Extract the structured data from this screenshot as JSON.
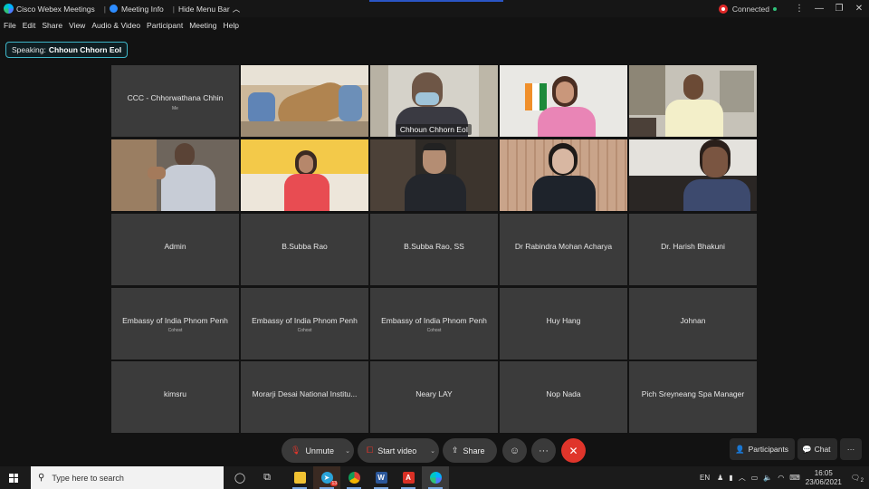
{
  "titlebar": {
    "app_title": "Cisco Webex Meetings",
    "separator": "|",
    "meeting_info": "Meeting Info",
    "hide_menu": "Hide Menu Bar",
    "hide_menu_icon": "chevron-up-icon",
    "status": "Connected",
    "status_color": "#2fc27a",
    "recording_color": "#e02828"
  },
  "menu": [
    "File",
    "Edit",
    "Share",
    "View",
    "Audio & Video",
    "Participant",
    "Meeting",
    "Help"
  ],
  "speaking": {
    "label": "Speaking:",
    "name": "Chhoun Chhorn EoI",
    "border_color": "#3fb6c8"
  },
  "tiles": [
    {
      "name": "CCC - Chhorwathana Chhin",
      "sub": "Me",
      "video": false
    },
    {
      "name": "",
      "sub": "",
      "video": true
    },
    {
      "name": "Chhoun Chhorn EoI",
      "sub": "",
      "video": true,
      "active": true
    },
    {
      "name": "",
      "sub": "",
      "video": true
    },
    {
      "name": "",
      "sub": "",
      "video": true
    },
    {
      "name": "",
      "sub": "",
      "video": true
    },
    {
      "name": "",
      "sub": "",
      "video": true
    },
    {
      "name": "",
      "sub": "",
      "video": true
    },
    {
      "name": "",
      "sub": "",
      "video": true
    },
    {
      "name": "",
      "sub": "",
      "video": true
    },
    {
      "name": "Admin",
      "sub": "",
      "video": false
    },
    {
      "name": "B.Subba Rao",
      "sub": "",
      "video": false
    },
    {
      "name": "B.Subba Rao, SS",
      "sub": "",
      "video": false
    },
    {
      "name": "Dr Rabindra Mohan Acharya",
      "sub": "",
      "video": false
    },
    {
      "name": "Dr. Harish Bhakuni",
      "sub": "",
      "video": false
    },
    {
      "name": "Embassy of India Phnom Penh",
      "sub": "Cohost",
      "video": false
    },
    {
      "name": "Embassy of India Phnom Penh",
      "sub": "Cohost",
      "video": false
    },
    {
      "name": "Embassy of India Phnom Penh",
      "sub": "Cohost",
      "video": false
    },
    {
      "name": "Huy Hang",
      "sub": "",
      "video": false
    },
    {
      "name": "Johnan",
      "sub": "",
      "video": false
    },
    {
      "name": "kimsru",
      "sub": "",
      "video": false
    },
    {
      "name": "Morarji Desai National Institu...",
      "sub": "",
      "video": false
    },
    {
      "name": "Neary LAY",
      "sub": "",
      "video": false
    },
    {
      "name": "Nop Nada",
      "sub": "",
      "video": false
    },
    {
      "name": "Pich Sreyneang Spa Manager",
      "sub": "",
      "video": false
    }
  ],
  "controls": {
    "unmute": "Unmute",
    "start_video": "Start video",
    "share": "Share",
    "reactions_icon": "smile-icon",
    "more_icon": "more-horizontal-icon",
    "leave_icon": "close-icon",
    "leave_color": "#e0352b",
    "participants": "Participants",
    "chat": "Chat",
    "panel_more_icon": "more-horizontal-icon"
  },
  "taskbar": {
    "search_placeholder": "Type here to search",
    "language": "EN",
    "time": "16:05",
    "date": "23/06/2021",
    "notification_count": "2",
    "telegram_badge": "13"
  }
}
